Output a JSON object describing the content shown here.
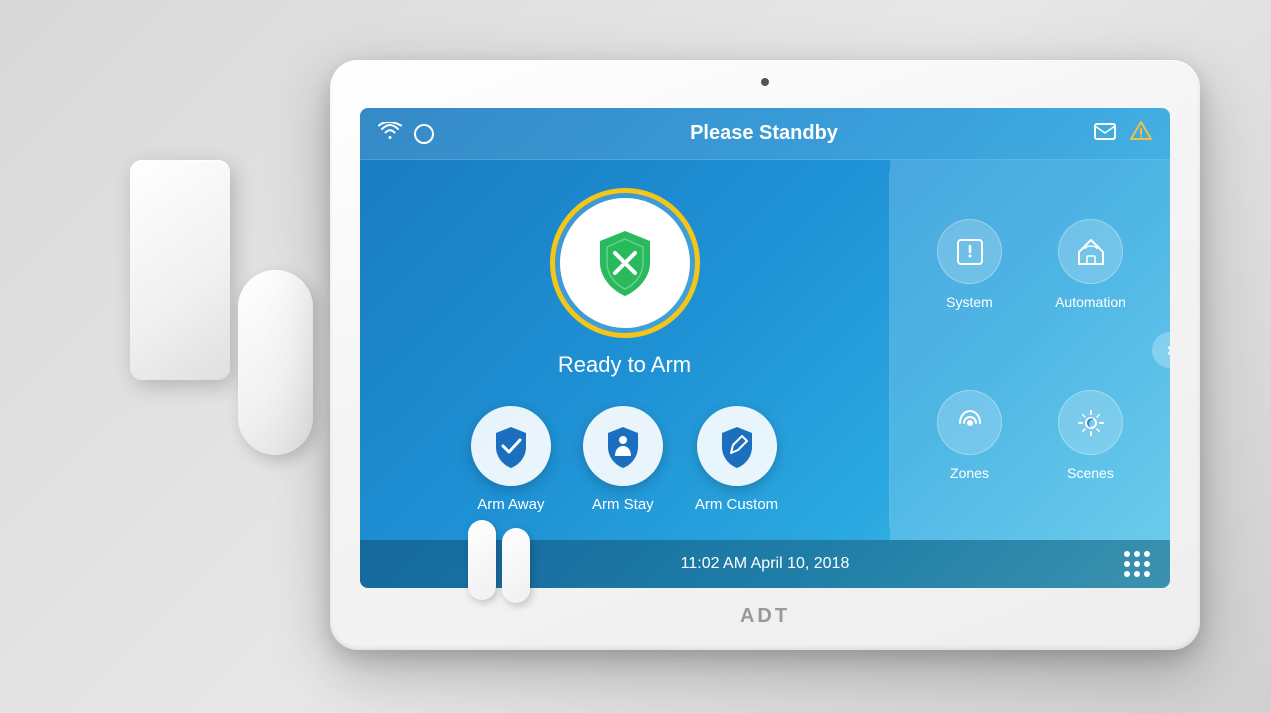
{
  "device": {
    "brand": "ADT",
    "camera_alt": "front camera"
  },
  "screen": {
    "status_bar": {
      "title": "Please Standby",
      "wifi_icon": "wifi",
      "signal_icon": "circle",
      "message_icon": "envelope",
      "alert_icon": "warning"
    },
    "main": {
      "ready_label": "Ready to Arm",
      "arm_buttons": [
        {
          "label": "Arm Away",
          "icon": "check-shield"
        },
        {
          "label": "Arm Stay",
          "icon": "person-shield"
        },
        {
          "label": "Arm Custom",
          "icon": "pencil-shield"
        }
      ],
      "nav_items": [
        {
          "label": "System",
          "icon": "info"
        },
        {
          "label": "Automation",
          "icon": "home"
        },
        {
          "label": "Zones",
          "icon": "signal"
        },
        {
          "label": "Scenes",
          "icon": "scenes"
        }
      ],
      "chevron": "›"
    },
    "bottom_bar": {
      "datetime": "11:02 AM April 10, 2018",
      "grid_dots": 9
    }
  }
}
